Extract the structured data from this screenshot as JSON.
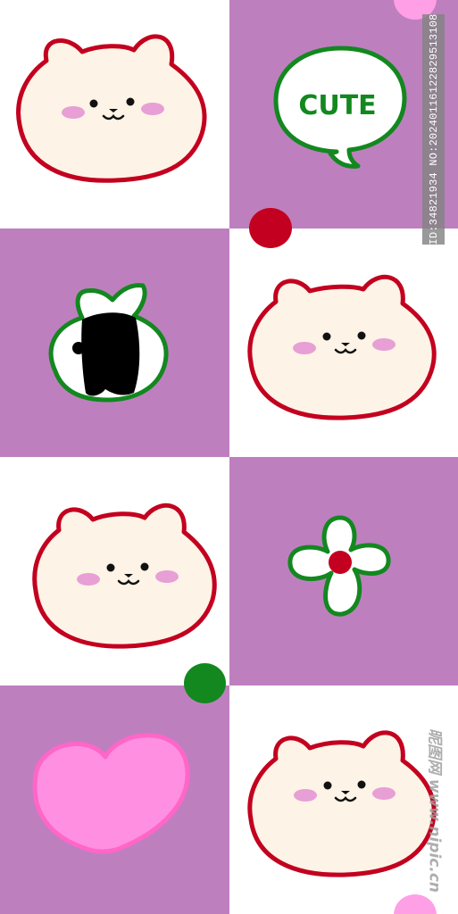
{
  "pattern": {
    "colors": {
      "purple": "#be7fbf",
      "white": "#ffffff",
      "cream": "#fdf3e6",
      "outline_red": "#c3001f",
      "blush": "#e79fd6",
      "green": "#12881f",
      "heart_pink": "#ff8fe0",
      "heart_outline": "#ff66c8",
      "pink_dot": "#ff9fe6"
    },
    "tiles": [
      {
        "icon": "bear-face-icon",
        "bg": "white"
      },
      {
        "icon": "speech-bubble-icon",
        "bg": "purple"
      },
      {
        "icon": "onigiri-icon",
        "bg": "purple"
      },
      {
        "icon": "bear-face-icon",
        "bg": "white"
      },
      {
        "icon": "bear-face-icon",
        "bg": "white"
      },
      {
        "icon": "flower-icon",
        "bg": "purple"
      },
      {
        "icon": "heart-icon",
        "bg": "purple"
      },
      {
        "icon": "bear-face-icon",
        "bg": "white"
      }
    ]
  },
  "speech_bubble": {
    "text": "CUTE"
  },
  "watermark": {
    "id_text": "ID:34821934 NO:20240116122829513108",
    "site_text": "昵图网 www.nipic.cn"
  }
}
